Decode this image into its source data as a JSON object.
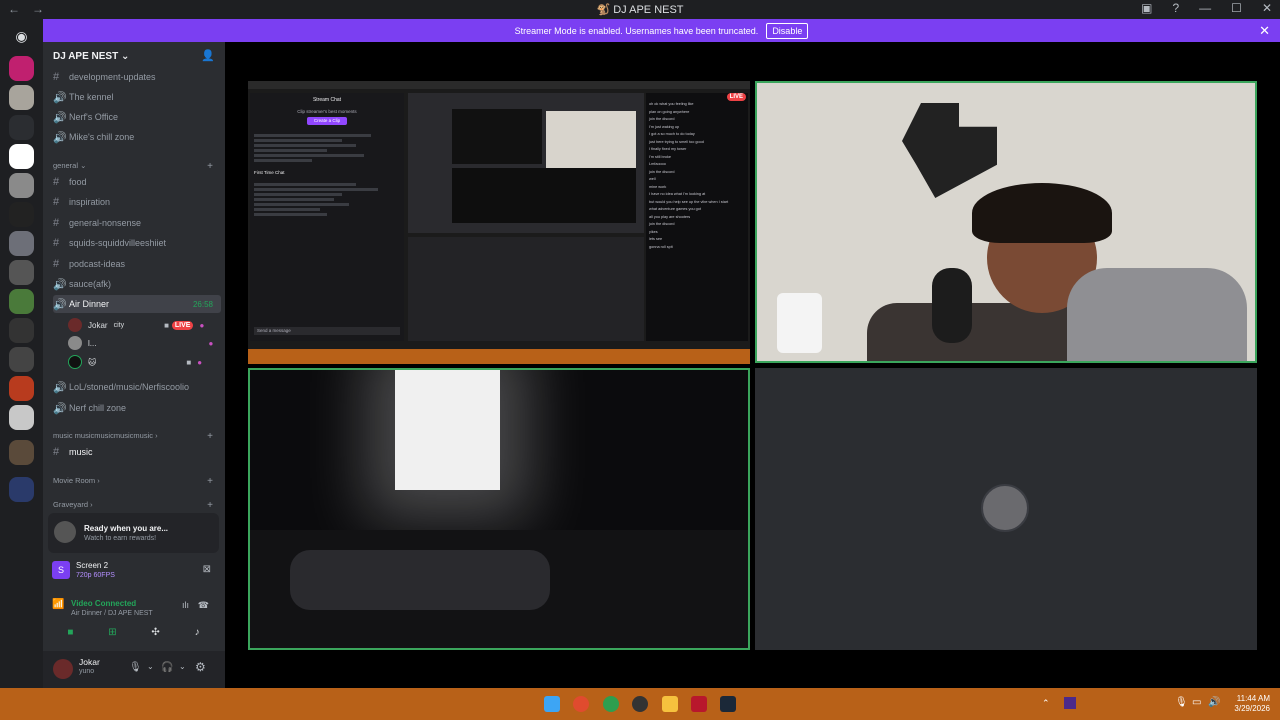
{
  "window": {
    "title": "DJ APE NEST",
    "back": "←",
    "forward": "→"
  },
  "banner": {
    "text": "Streamer Mode is enabled. Usernames have been truncated.",
    "button": "Disable"
  },
  "server": {
    "name": "DJ APE NEST"
  },
  "channels_top": [
    {
      "icon": "#",
      "label": "development-updates"
    },
    {
      "icon": "🔊",
      "label": "The kennel"
    },
    {
      "icon": "🔊",
      "label": "Nerf's Office"
    },
    {
      "icon": "🔊",
      "label": "Mike's chill zone"
    }
  ],
  "category_general": "general",
  "channels_general": [
    {
      "icon": "#",
      "label": "food"
    },
    {
      "icon": "#",
      "label": "inspiration"
    },
    {
      "icon": "#",
      "label": "general-nonsense"
    },
    {
      "icon": "#",
      "label": "squids-squiddvilleeshiiet"
    },
    {
      "icon": "#",
      "label": "podcast-ideas"
    },
    {
      "icon": "🔊",
      "label": "sauce(afk)"
    }
  ],
  "voice_active": {
    "label": "Air Dinner",
    "timer": "26:58"
  },
  "voice_users": [
    {
      "name": "Jokar",
      "extra": "city",
      "badge": "LIVE"
    },
    {
      "name": "l...",
      "extra": "",
      "badge": ""
    },
    {
      "name": "🐱",
      "extra": "",
      "badge": ""
    }
  ],
  "channels_after": [
    {
      "icon": "🔊",
      "label": "LoL/stoned/music/Nerfiscoolio"
    },
    {
      "icon": "🔊",
      "label": "Nerf chill zone"
    }
  ],
  "category_music": "music musicmusicmusicmusic",
  "channel_music": {
    "icon": "#",
    "label": "music"
  },
  "category_movie": "Movie Room",
  "category_graveyard": "Graveyard",
  "rewards": {
    "title": "Ready when you are...",
    "subtitle": "Watch to earn rewards!"
  },
  "screen_share": {
    "title": "Screen 2",
    "sub": "720p 60FPS"
  },
  "connection": {
    "title": "Video Connected",
    "sub": "Air Dinner / DJ APE NEST"
  },
  "user": {
    "name": "Jokar",
    "status": "yuno"
  },
  "stream_preview": {
    "live_badge": "LIVE",
    "chat_title": "Stream Chat",
    "clip_prompt": "Clip streamer's best moments",
    "clip_button": "Create a Clip",
    "first_chat": "First Time Chat",
    "chat_lines": [
      "oh ok what you feeling like",
      "plan on going anywhere",
      "join the discord",
      "I'm just waking up",
      "I got a so much to do today",
      "just here trying to smell too good",
      "I finally fixed my tower",
      "I'm still broke",
      "Lmfaoooo",
      "join the discord",
      "well",
      "mine work",
      "I have no idea what I'm looking at",
      "but would you help see up the vibe when I start",
      "what adventure games you got",
      "all you play are shooters",
      "join the discord",
      "yikes",
      "lets see",
      "gonna roll spit"
    ],
    "message_placeholder": "Send a message"
  },
  "taskbar": {
    "time": "11:44 AM",
    "date": "3/29/2026"
  },
  "colors": {
    "accent": "#7b3ff2",
    "taskbar": "#b86118",
    "live": "#ed4245",
    "green": "#23a55a",
    "tile_border": "#3ba55c"
  }
}
